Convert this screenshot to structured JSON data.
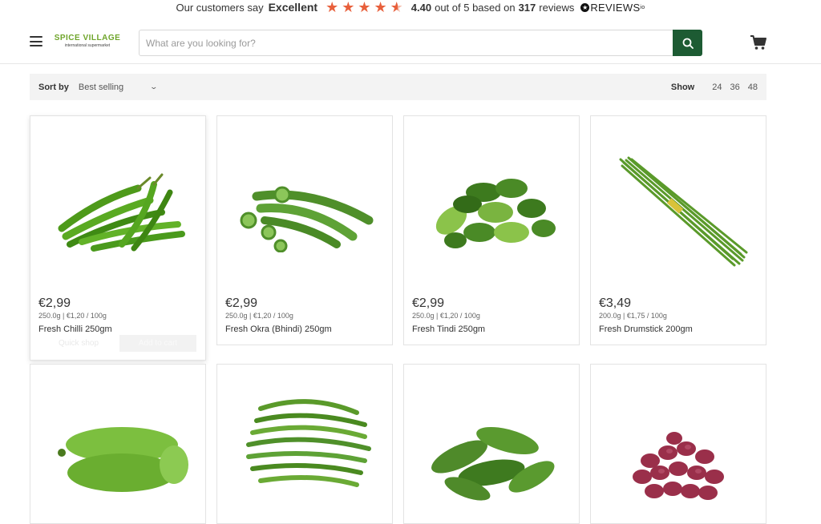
{
  "reviews_bar": {
    "prefix": "Our customers say",
    "rating_word": "Excellent",
    "rating_value": "4.40",
    "out_of_text": "out of 5 based on",
    "review_count": "317",
    "reviews_word": "reviews",
    "brand": "REVIEWS",
    "brand_suffix": "io",
    "star_rating": 4.4,
    "star_color": "#e8603c"
  },
  "header": {
    "logo_name": "SPICE VILLAGE",
    "logo_tagline": "international supermarket",
    "search_placeholder": "What are you looking for?",
    "search_icon": "search-icon",
    "cart_icon": "cart-icon",
    "menu_icon": "hamburger-icon",
    "accent_color": "#1d5b33"
  },
  "sortbar": {
    "sort_label": "Sort by",
    "sort_value": "Best selling",
    "show_label": "Show",
    "show_options": [
      "24",
      "36",
      "48"
    ]
  },
  "products": [
    {
      "price": "€2,99",
      "unit": "250.0g | €1,20 / 100g",
      "title": "Fresh Chilli 250gm",
      "quick_shop": "Quick shop",
      "add_to_cart": "Add to cart",
      "image_icon": "chilli-image"
    },
    {
      "price": "€2,99",
      "unit": "250.0g | €1,20 / 100g",
      "title": "Fresh Okra (Bhindi) 250gm",
      "image_icon": "okra-image"
    },
    {
      "price": "€2,99",
      "unit": "250.0g | €1,20 / 100g",
      "title": "Fresh Tindi 250gm",
      "image_icon": "tindi-image"
    },
    {
      "price": "€3,49",
      "unit": "200.0g | €1,75 / 100g",
      "title": "Fresh Drumstick 200gm",
      "image_icon": "drumstick-image"
    },
    {
      "image_icon": "bottle-gourd-image"
    },
    {
      "image_icon": "green-beans-image"
    },
    {
      "image_icon": "bitter-gourd-image"
    },
    {
      "image_icon": "shallots-image"
    }
  ]
}
